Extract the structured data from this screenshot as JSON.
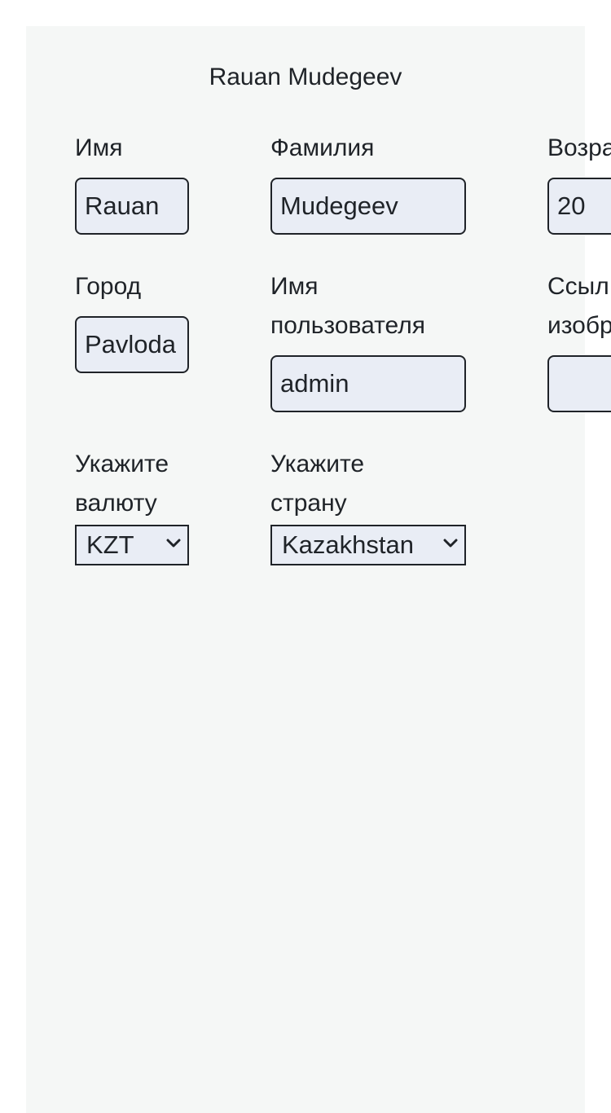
{
  "profile": {
    "full_name": "Rauan Mudegeev"
  },
  "fields": {
    "first_name": {
      "label": "Имя",
      "value": "Rauan"
    },
    "last_name": {
      "label": "Фамилия",
      "value": "Mudegeev"
    },
    "age": {
      "label": "Возра",
      "value": "20"
    },
    "city": {
      "label": "Город",
      "value": "Pavloda"
    },
    "username": {
      "label_line1": "Имя",
      "label_line2": "пользователя",
      "value": "admin"
    },
    "image_link": {
      "label_line1": "Ссыл",
      "label_line2": "изобр",
      "value": ""
    },
    "currency": {
      "label_line1": "Укажите",
      "label_line2": "валюту",
      "selected": "KZT"
    },
    "country": {
      "label_line1": "Укажите",
      "label_line2": "страну",
      "selected": "Kazakhstan"
    }
  },
  "icons": {
    "select_arrow": "chevron-down-icon"
  }
}
